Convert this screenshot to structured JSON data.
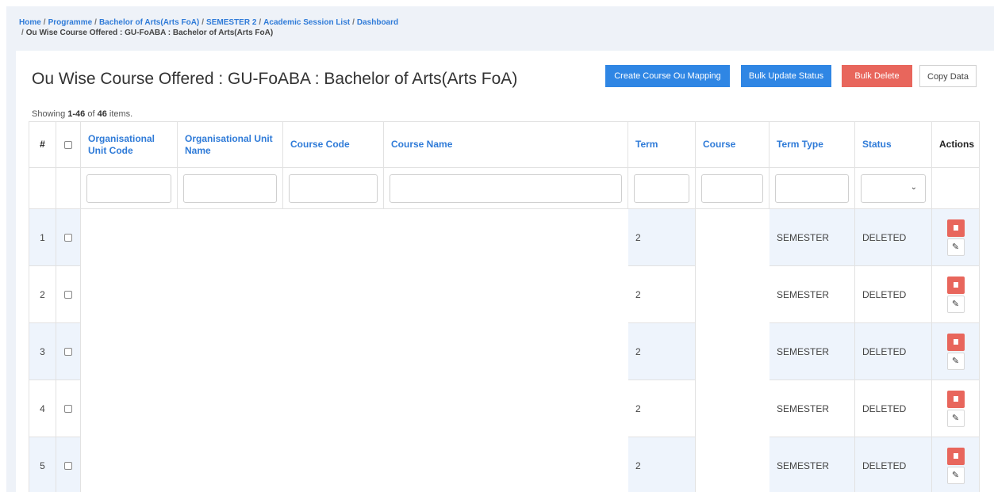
{
  "breadcrumb": {
    "items": [
      "Home",
      "Programme",
      "Bachelor of Arts(Arts FoA)",
      "SEMESTER 2",
      "Academic Session List",
      "Dashboard"
    ],
    "current": "Ou Wise Course Offered : GU-FoABA : Bachelor of Arts(Arts FoA)"
  },
  "page": {
    "title": "Ou Wise Course Offered : GU-FoABA : Bachelor of Arts(Arts FoA)"
  },
  "toolbar": {
    "create_label": "Create Course Ou Mapping",
    "bulk_update_label": "Bulk Update Status",
    "bulk_delete_label": "Bulk Delete",
    "copy_label": "Copy Data"
  },
  "summary": {
    "prefix": "Showing ",
    "range": "1-46",
    "middle": " of ",
    "total": "46",
    "suffix": " items."
  },
  "table": {
    "columns": {
      "num": "#",
      "ou_code": "Organisational Unit Code",
      "ou_name": "Organisational Unit Name",
      "course_code": "Course Code",
      "course_name": "Course Name",
      "term": "Term",
      "course": "Course",
      "term_type": "Term Type",
      "status": "Status",
      "actions": "Actions"
    },
    "rows": [
      {
        "num": "1",
        "term": "2",
        "term_type": "SEMESTER",
        "status": "DELETED"
      },
      {
        "num": "2",
        "term": "2",
        "term_type": "SEMESTER",
        "status": "DELETED"
      },
      {
        "num": "3",
        "term": "2",
        "term_type": "SEMESTER",
        "status": "DELETED"
      },
      {
        "num": "4",
        "term": "2",
        "term_type": "SEMESTER",
        "status": "DELETED"
      },
      {
        "num": "5",
        "term": "2",
        "term_type": "SEMESTER",
        "status": "DELETED"
      }
    ]
  },
  "icons": {
    "delete": "trash-icon",
    "edit": "pencil-icon",
    "select": "chevron-down-icon"
  },
  "colors": {
    "primary": "#2f86e4",
    "danger": "#e8665c",
    "link": "#2f7bd8",
    "row_alt": "#eef4fc"
  }
}
